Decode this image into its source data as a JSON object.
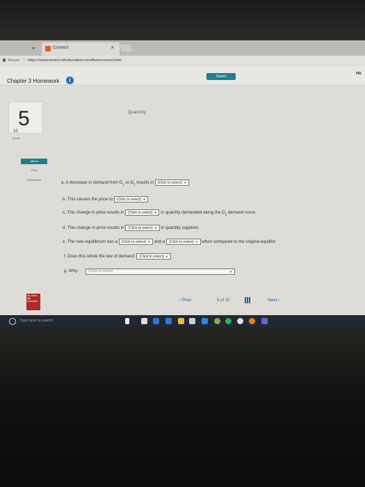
{
  "browser": {
    "tab_title": "Connect",
    "tab_close": "×",
    "left_close": "×",
    "secure_label": "Secure",
    "separator": "|",
    "url": "https://newconnect.mheducation.com/flow/connect.html"
  },
  "header": {
    "chapter": "Chapter 3 Homework",
    "info_glyph": "i",
    "saved": "Saved",
    "help": "He"
  },
  "question": {
    "number": "5",
    "partial_label": "Quantity",
    "points_value": "10",
    "points_label": "points"
  },
  "sidebar": [
    "eBook",
    "Print",
    "References"
  ],
  "parts": {
    "a": {
      "text_before": "a. A decrease in demand from D",
      "d1_sub": "1",
      "mid": " to D",
      "d2_sub": "2",
      "text_after": " results in",
      "select": "(Click to select)"
    },
    "b": {
      "text_before": "b. This causes the price to",
      "select": "(Click to select)"
    },
    "c": {
      "text_before": "c. This change in price results in",
      "select": "(Click to select)",
      "text_after": "in quantity demanded along the D",
      "sub": "2",
      "text_end": " demand curve."
    },
    "d": {
      "text_before": "d. This change in price results in",
      "select": "(Click to select)",
      "text_after": "in quantity supplied."
    },
    "e": {
      "text_before": "e. The new equilibrium has a",
      "select1": "(Click to select)",
      "mid": "and a",
      "select2": "(Click to select)",
      "text_after": "when compared to the original equilibri"
    },
    "f": {
      "text_before": "f. Does this refute the law of demand:",
      "select": "(Click to select)"
    },
    "g": {
      "text_before": "g. Why:",
      "select": "(Click to select)"
    }
  },
  "arrow_glyph": "▼",
  "pagination": {
    "prev": "‹  Prev",
    "current": "5",
    "of": "of",
    "total": "10",
    "next": "Next  ›"
  },
  "logo_text": "Mc Graw Hill Education",
  "taskbar": {
    "search_placeholder": "Type here to search"
  }
}
